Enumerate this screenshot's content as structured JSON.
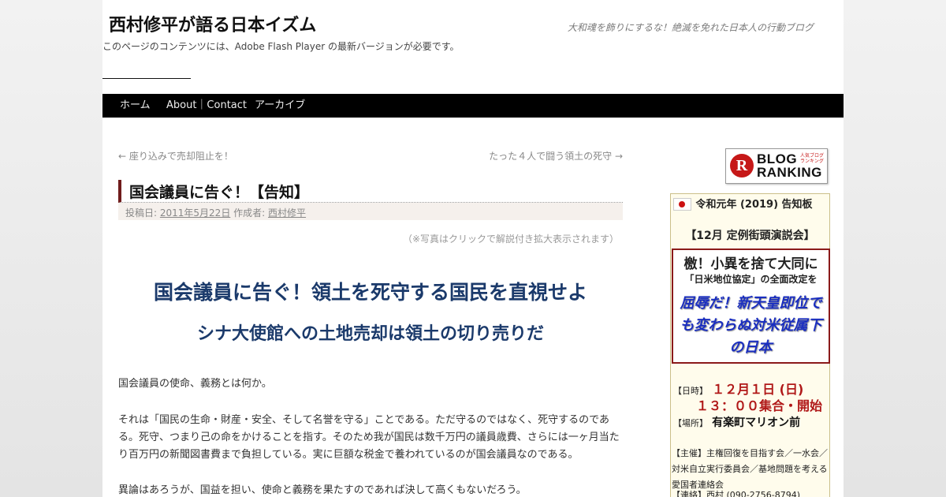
{
  "site": {
    "title": "西村修平が語る日本イズム",
    "description": "大和魂を飾りにするな！絶滅を免れた日本人の行動ブログ",
    "flash_notice": "このページのコンテンツには、Adobe Flash Player の最新バージョンが必要です。"
  },
  "nav": {
    "items": [
      {
        "label": "ホーム"
      },
      {
        "label": "About｜Contact"
      },
      {
        "label": "アーカイブ"
      }
    ]
  },
  "post_nav": {
    "prev": "← 座り込みで売却阻止を！",
    "next": "たった４人で闘う領土の死守 →"
  },
  "post": {
    "title": "国会議員に告ぐ！【告知】",
    "meta_posted_label": "投稿日:",
    "meta_date": "2011年5月22日",
    "meta_author_label": "作成者:",
    "meta_author": "西村修平",
    "photo_note": "（※写真はクリックで解説付き拡大表示されます）",
    "headline_1": "国会議員に告ぐ！領土を死守する国民を直視せよ",
    "headline_2": "シナ大使館への土地売却は領土の切り売りだ",
    "paragraphs": [
      "国会議員の使命、義務とは何か。",
      "それは「国民の生命・財産・安全、そして名誉を守る」ことである。ただ守るのではなく、死守するのである。死守、つまり己の命をかけることを指す。そのため我が国民は数千万円の議員歳費、さらには一ヶ月当たり百万円の新聞図書費まで負担している。実に巨額な税金で養われているのが国会議員なのである。",
      "異論はあろうが、国益を担い、使命と義務を果たすのであれば決して高くもないだろう。"
    ]
  },
  "sidebar": {
    "ranking_badge": {
      "letter": "R",
      "line1": "BLOG",
      "line2": "RANKING",
      "small": "人気ブログランキング"
    },
    "notice": {
      "title": "令和元年 (2019) 告知板",
      "event_title": "【12月 定例街頭演説会】",
      "box_line1": "檄！小異を捨て大同に",
      "box_line2": "「日米地位協定」の全面改定を",
      "box_line3": "屈辱だ！新天皇即位でも変わらぬ対米従属下の日本",
      "date_label": "【日時】",
      "date_value": "１２月１日 (日)",
      "time_value": "１３：００集合・開始",
      "place_label": "【場所】",
      "place_value": "有楽町マリオン前",
      "organizers": "【主催】主権回復を目指す会／一水会／対米自立実行委員会／基地問題を考える愛国者連絡会",
      "contact": "【連絡】西村 (090-2756-8794)"
    }
  },
  "colors": {
    "nav_bg": "#000000",
    "title_bar_accent": "#701c1c",
    "headline": "#1b3a6b",
    "event_red": "#b01818",
    "box_blue_text": "#1a2ec0",
    "widget_bg": "#fffcec"
  }
}
